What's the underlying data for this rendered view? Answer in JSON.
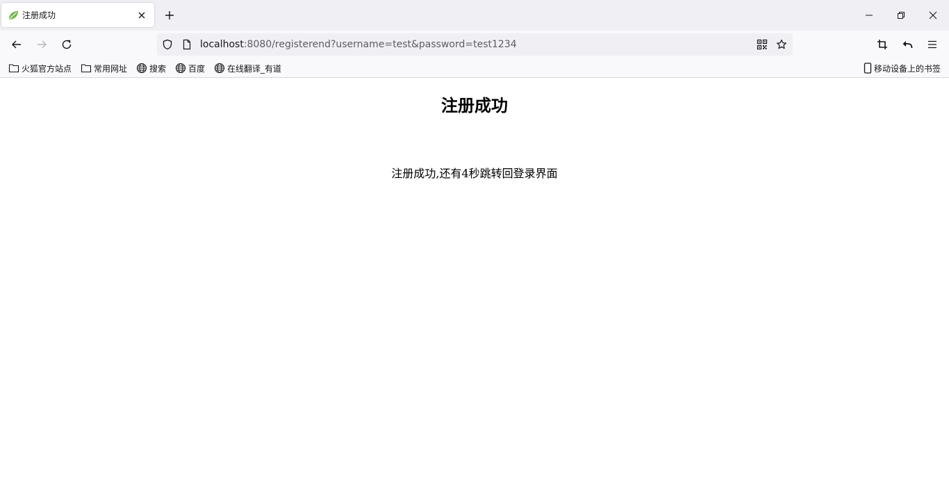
{
  "tab": {
    "title": "注册成功"
  },
  "address": {
    "host": "localhost",
    "rest": ":8080/registerend?username=test&password=test1234"
  },
  "bookmarks": {
    "items": [
      {
        "label": "火狐官方站点",
        "icon": "folder-icon"
      },
      {
        "label": "常用网址",
        "icon": "folder-icon"
      },
      {
        "label": "搜索",
        "icon": "globe-icon"
      },
      {
        "label": "百度",
        "icon": "globe-icon"
      },
      {
        "label": "在线翻译_有道",
        "icon": "globe-icon"
      }
    ],
    "mobile": "移动设备上的书签"
  },
  "page": {
    "title": "注册成功",
    "message": "注册成功,还有4秒跳转回登录界面"
  },
  "colors": {
    "tabstrip": "#f0f0f4",
    "toolbar": "#f9f9fb",
    "favicon": "#6db33f"
  }
}
